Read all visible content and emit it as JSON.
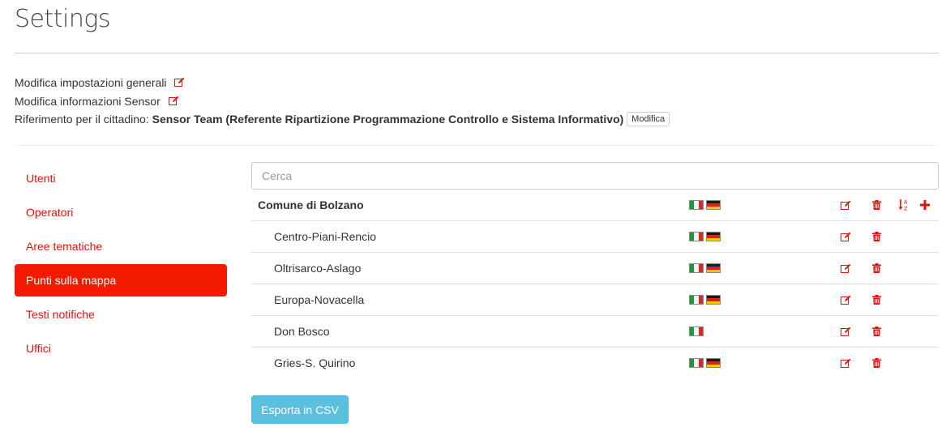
{
  "page": {
    "title": "Settings"
  },
  "settings": {
    "general_label": "Modifica impostazioni generali",
    "sensor_label": "Modifica informazioni Sensor",
    "citizen_ref_prefix": "Riferimento per il cittadino:",
    "citizen_ref_value": "Sensor Team (Referente Ripartizione Programmazione Controllo e Sistema Informativo)",
    "modify_label": "Modifica"
  },
  "sidebar": {
    "items": [
      {
        "label": "Utenti",
        "active": false
      },
      {
        "label": "Operatori",
        "active": false
      },
      {
        "label": "Aree tematiche",
        "active": false
      },
      {
        "label": "Punti sulla mappa",
        "active": true
      },
      {
        "label": "Testi notifiche",
        "active": false
      },
      {
        "label": "Uffici",
        "active": false
      }
    ]
  },
  "search": {
    "placeholder": "Cerca",
    "value": ""
  },
  "tree": {
    "root": {
      "label": "Comune di Bolzano",
      "flags": [
        "it",
        "de"
      ]
    },
    "children": [
      {
        "label": "Centro-Piani-Rencio",
        "flags": [
          "it",
          "de"
        ]
      },
      {
        "label": "Oltrisarco-Aslago",
        "flags": [
          "it",
          "de"
        ]
      },
      {
        "label": "Europa-Novacella",
        "flags": [
          "it",
          "de"
        ]
      },
      {
        "label": "Don Bosco",
        "flags": [
          "it"
        ]
      },
      {
        "label": "Gries-S. Quirino",
        "flags": [
          "it",
          "de"
        ]
      }
    ]
  },
  "icons": {
    "edit": "edit-icon",
    "trash": "trash-icon",
    "sort": "sort-alpha-icon",
    "add": "plus-icon"
  },
  "colors": {
    "accent": "#e3120b",
    "active_bg": "#f41a02",
    "info_button": "#5bc0de"
  },
  "export": {
    "label": "Esporta in CSV"
  }
}
